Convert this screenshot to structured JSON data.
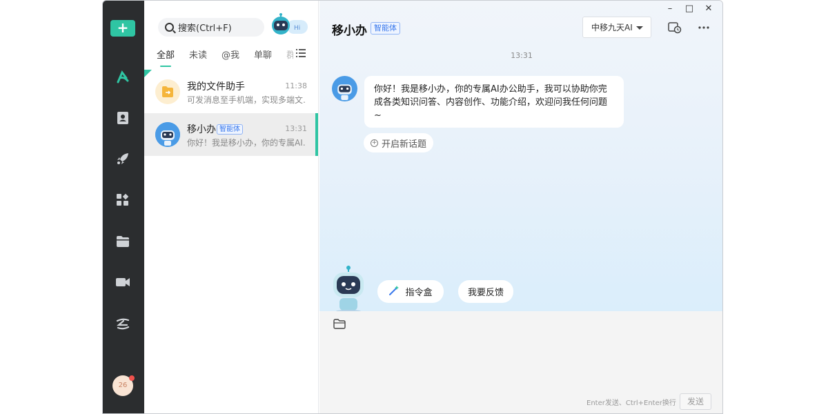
{
  "rail": {
    "new_label": "+",
    "avatar_count": "26",
    "icons": [
      "logo-icon",
      "contacts-icon",
      "rocket-icon",
      "apps-icon",
      "folder-icon",
      "video-icon",
      "cloud-icon"
    ]
  },
  "search": {
    "placeholder": "搜索(Ctrl+F)"
  },
  "hi_label": "Hi",
  "tabs": [
    "全部",
    "未读",
    "@我",
    "单聊",
    "群"
  ],
  "conversations": [
    {
      "name": "我的文件助手",
      "time": "11:38",
      "preview": "可发消息至手机端，实现多端文…"
    },
    {
      "name": "移小办",
      "badge": "智能体",
      "time": "13:31",
      "preview": "你好！我是移小办，你的专属AI…"
    }
  ],
  "chat": {
    "title": "移小办",
    "badge": "智能体",
    "model": "中移九天AI",
    "timestamp": "13:31",
    "message": "你好！我是移小办，你的专属AI办公助手，我可以协助你完成各类知识问答、内容创作、功能介绍，欢迎问我任何问题~",
    "new_topic": "开启新话题",
    "quick_actions": [
      "指令盒",
      "我要反馈"
    ],
    "hint": "Enter发送、Ctrl+Enter换行",
    "send": "发送"
  },
  "window_controls": {
    "minimize": "–",
    "maximize": "□",
    "close": "✕"
  },
  "colors": {
    "accent": "#2fc5a3",
    "rail": "#2b2d2f",
    "badge": "#3a79ec"
  }
}
